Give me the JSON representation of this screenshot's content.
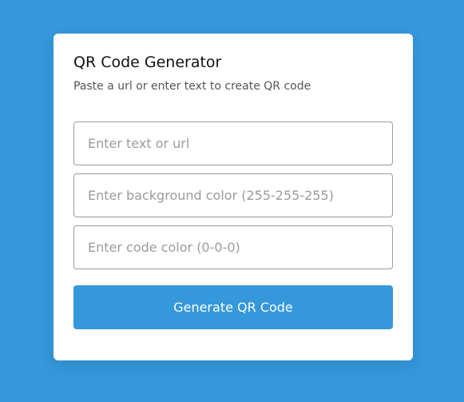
{
  "app": {
    "title": "QR Code Generator",
    "subtitle": "Paste a url or enter text to create QR code"
  },
  "form": {
    "text_input": {
      "placeholder": "Enter text or url",
      "value": ""
    },
    "bg_color_input": {
      "placeholder": "Enter background color (255-255-255)",
      "value": ""
    },
    "code_color_input": {
      "placeholder": "Enter code color (0-0-0)",
      "value": ""
    },
    "generate_label": "Generate QR Code"
  },
  "colors": {
    "page_background": "#3498db",
    "card_background": "#ffffff",
    "accent": "#3498db",
    "button_text": "#ffffff",
    "input_border": "#9a9a9a"
  }
}
